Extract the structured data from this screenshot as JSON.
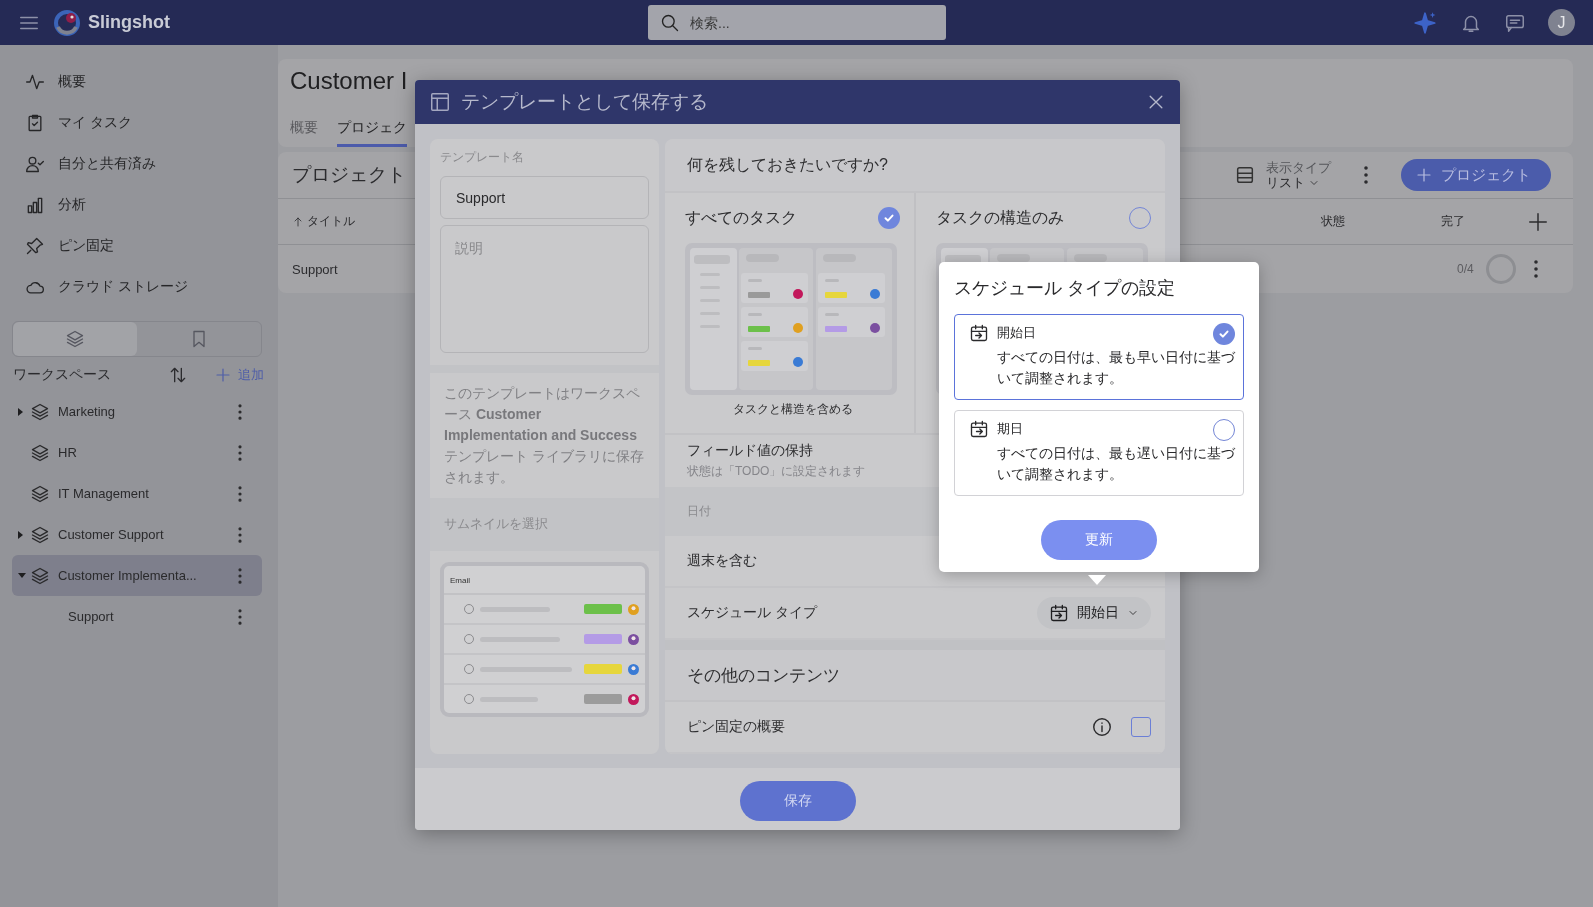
{
  "topbar": {
    "app_name": "Slingshot",
    "search": {
      "placeholder": "検索..."
    },
    "avatar": "J"
  },
  "sidebar": {
    "nav": [
      {
        "label": "概要"
      },
      {
        "label": "マイ タスク"
      },
      {
        "label": "自分と共有済み"
      },
      {
        "label": "分析"
      },
      {
        "label": "ピン固定"
      },
      {
        "label": "クラウド ストレージ"
      }
    ],
    "view_tabs": [
      {
        "selected": true
      },
      {
        "selected": false
      }
    ],
    "workspace_header": {
      "title": "ワークスペース",
      "add": "追加"
    },
    "workspaces": [
      {
        "name": "Marketing",
        "has_children": true,
        "expanded": false,
        "selected": false
      },
      {
        "name": "HR",
        "has_children": false,
        "expanded": false,
        "selected": false
      },
      {
        "name": "IT Management",
        "has_children": false,
        "expanded": false,
        "selected": false
      },
      {
        "name": "Customer Support",
        "has_children": true,
        "expanded": false,
        "selected": false
      },
      {
        "name": "Customer Implementa...",
        "has_children": true,
        "expanded": true,
        "selected": true,
        "children": [
          {
            "name": "Support",
            "selected": false
          }
        ]
      }
    ]
  },
  "page": {
    "title": "Customer I",
    "tabs": [
      {
        "label": "概要",
        "selected": false
      },
      {
        "label": "プロジェク",
        "selected": true
      }
    ]
  },
  "projects": {
    "title": "プロジェクト",
    "view_type": {
      "label": "表示タイプ",
      "value": "リスト"
    },
    "add_button": "プロジェクト",
    "columns": [
      "タイトル",
      "状態",
      "完了"
    ],
    "rows": [
      {
        "title": "Support",
        "progress": "0/4"
      }
    ]
  },
  "modal": {
    "title": "テンプレートとして保存する",
    "name_label": "テンプレート名",
    "name_value": "Support",
    "description_placeholder": "説明",
    "info": "このテンプレートはワークスペース **Customer Implementation and Success** テンプレート ライブラリに保存されます。",
    "thumbnail_label": "サムネイルを選択",
    "thumbnail": {
      "title": "Email",
      "rows": [
        {
          "color": "#6cc04a"
        },
        {
          "color": "#b49be6"
        },
        {
          "color": "#e6d63c"
        },
        {
          "color": "#9c9c9c"
        }
      ]
    },
    "question": "何を残しておきたいですか?",
    "options": [
      {
        "title": "すべてのタスク",
        "selected": true,
        "caption": "タスクと構造を含める"
      },
      {
        "title": "タスクの構造のみ",
        "selected": false
      }
    ],
    "field_values": {
      "title": "フィールド値の保持",
      "subtitle": "状態は「TODO」に設定されます"
    },
    "dates_section": "日付",
    "weekend": {
      "label": "週末を含む"
    },
    "schedule": {
      "label": "スケジュール タイプ",
      "value": "開始日"
    },
    "other_section": "その他のコンテンツ",
    "pinned": {
      "label": "ピン固定の概要",
      "checked": false
    },
    "save": "保存"
  },
  "schedule_popup": {
    "title": "スケジュール タイプの設定",
    "options": [
      {
        "title": "開始日",
        "description": "すべての日付は、最も早い日付に基づいて調整されます。",
        "selected": true
      },
      {
        "title": "期日",
        "description": "すべての日付は、最も遅い日付に基づいて調整されます。",
        "selected": false
      }
    ],
    "update": "更新"
  }
}
